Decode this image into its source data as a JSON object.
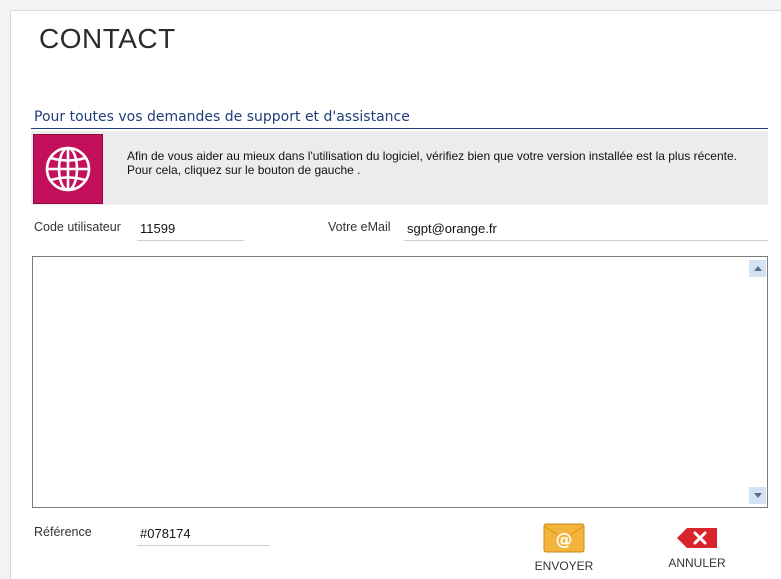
{
  "header": {
    "title": "CONTACT"
  },
  "support": {
    "section_title": "Pour toutes vos demandes de support et d'assistance",
    "info_line1": "Afin de vous aider au mieux dans l'utilisation du logiciel, vérifiez bien que votre version installée est la plus récente.",
    "info_line2": "Pour cela, cliquez sur le bouton de gauche .",
    "accent_color": "#c2105a"
  },
  "form": {
    "user_code_label": "Code utilisateur",
    "user_code_value": "11599",
    "email_label": "Votre eMail",
    "email_value": "sgpt@orange.fr",
    "message_value": "",
    "reference_label": "Référence",
    "reference_value": "#078174"
  },
  "actions": {
    "send_label": "ENVOYER",
    "send_icon": "envelope-at-icon",
    "cancel_label": "ANNULER",
    "cancel_icon": "delete-x-icon"
  }
}
